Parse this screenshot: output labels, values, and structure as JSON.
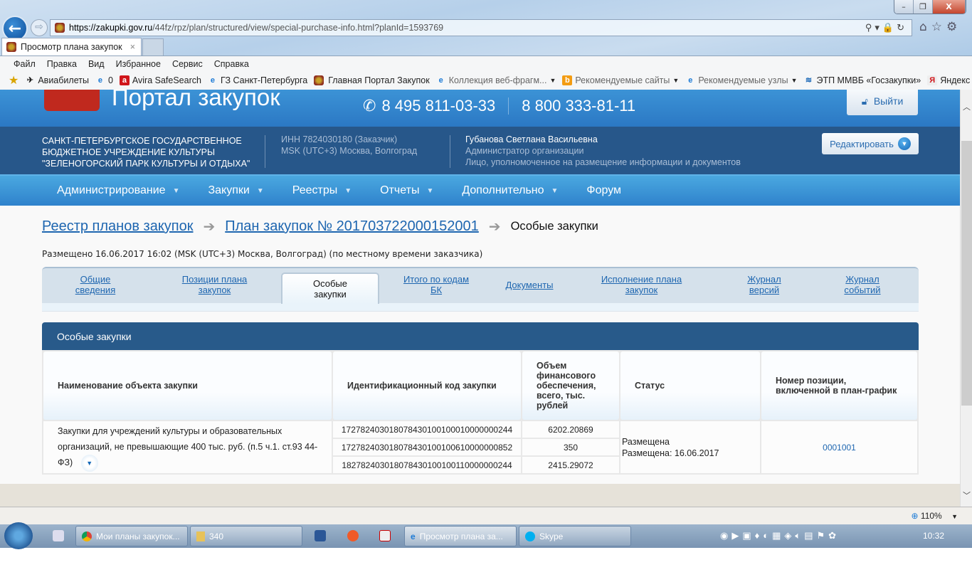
{
  "browser": {
    "url_domain": "https://zakupki.gov.ru",
    "url_path": "/44fz/rpz/plan/structured/view/special-purchase-info.html?planId=1593769",
    "tab_title": "Просмотр плана закупок",
    "window_buttons": [
      "–",
      "❐",
      "X"
    ],
    "menu": [
      "Файл",
      "Правка",
      "Вид",
      "Избранное",
      "Сервис",
      "Справка"
    ],
    "favorites": [
      {
        "label": "Авиабилеты"
      },
      {
        "label": "0"
      },
      {
        "label": "Avira SafeSearch"
      },
      {
        "label": "ГЗ Санкт-Петербурга"
      },
      {
        "label": "Главная Портал Закупок"
      },
      {
        "label": "Коллекция веб-фрагм..."
      },
      {
        "label": "Рекомендуемые сайты"
      },
      {
        "label": "Рекомендуемые узлы"
      },
      {
        "label": "ЭТП ММВБ «Госзакупки»"
      },
      {
        "label": "Яндекс"
      }
    ],
    "zoom": "110%"
  },
  "header": {
    "portal_title": "Портал закупок",
    "phone1": "8 495 811-03-33",
    "phone2": "8 800 333-81-11",
    "logout": "Выйти"
  },
  "org": {
    "name_lines": [
      "САНКТ-ПЕТЕРБУРГСКОЕ ГОСУДАРСТВЕННОЕ",
      "БЮДЖЕТНОЕ УЧРЕЖДЕНИЕ КУЛЬТУРЫ",
      "\"ЗЕЛЕНОГОРСКИЙ ПАРК КУЛЬТУРЫ И ОТДЫХА\""
    ],
    "inn": "ИНН 7824030180 (Заказчик)",
    "timezone": "MSK (UTC+3) Москва, Волгоград",
    "user": "Губанова Светлана Васильевна",
    "role": "Администратор организации",
    "role2": "Лицо, уполномоченное на размещение информации и документов",
    "edit": "Редактировать"
  },
  "nav": [
    {
      "label": "Администрирование"
    },
    {
      "label": "Закупки"
    },
    {
      "label": "Реестры"
    },
    {
      "label": "Отчеты"
    },
    {
      "label": "Дополнительно"
    },
    {
      "label": "Форум"
    }
  ],
  "breadcrumb": {
    "b1": "Реестр планов закупок",
    "b2": "План закупок № 201703722000152001",
    "current": "Особые закупки"
  },
  "posted": "Размещено 16.06.2017 16:02 (MSK (UTC+3) Москва, Волгоград) (по местному времени заказчика)",
  "tabs": [
    {
      "l1": "Общие",
      "l2": "сведения"
    },
    {
      "l1": "Позиции плана",
      "l2": "закупок"
    },
    {
      "l1": "Особые",
      "l2": "закупки"
    },
    {
      "l1": "Итого по кодам",
      "l2": "БК"
    },
    {
      "l1": "Документы",
      "l2": ""
    },
    {
      "l1": "Исполнение плана",
      "l2": "закупок"
    },
    {
      "l1": "Журнал",
      "l2": "версий"
    },
    {
      "l1": "Журнал",
      "l2": "событий"
    }
  ],
  "section": {
    "title": "Особые закупки"
  },
  "table": {
    "headers": [
      "Наименование объекта закупки",
      "Идентификационный код закупки",
      "Объем финансового обеспечения, всего, тыс. рублей",
      "Статус",
      "Номер позиции, включенной в план-график"
    ],
    "name": "Закупки для учреждений культуры и образовательных организаций, не превышающие 400 тыс. руб. (п.5 ч.1. ст.93 44-ФЗ)",
    "rows": [
      {
        "code": "172782403018078430100100010000000244",
        "amount": "6202.20869"
      },
      {
        "code": "172782403018078430100100610000000852",
        "amount": "350"
      },
      {
        "code": "182782403018078430100100110000000244",
        "amount": "2415.29072"
      }
    ],
    "status1": "Размещена",
    "status2": "Размещена: 16.06.2017",
    "position": "0001001"
  },
  "taskbar": {
    "items": [
      "Мои планы закупок...",
      "340",
      "Просмотр плана за...",
      "Skype"
    ],
    "clock": "10:32"
  }
}
